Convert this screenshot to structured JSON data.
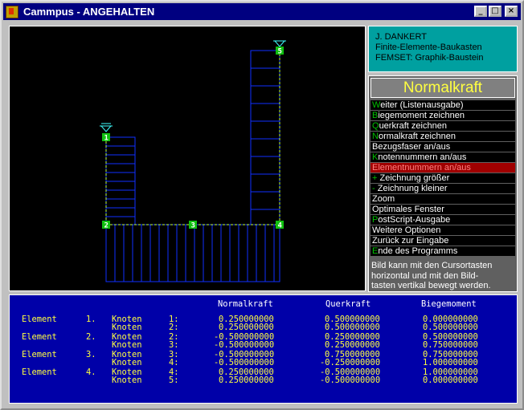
{
  "window": {
    "title": "Cammpus - ANGEHALTEN",
    "min_symbol": "_",
    "max_symbol": "□",
    "close_symbol": "×"
  },
  "info": {
    "line1": "J. DANKERT",
    "line2": "Finite-Elemente-Baukasten",
    "line3": "FEMSET:  Graphik-Baustein"
  },
  "menu": {
    "header": "Normalkraft",
    "items": [
      {
        "hk": "W",
        "rest": "eiter (Listenausgabe)"
      },
      {
        "hk": "B",
        "rest": "iegemoment zeichnen"
      },
      {
        "hk": "Q",
        "rest": "uerkraft zeichnen"
      },
      {
        "hk": "N",
        "rest": "ormalkraft zeichnen"
      },
      {
        "hk": "",
        "rest": "Bezugsfaser an/aus"
      },
      {
        "hk": "K",
        "rest": "notennummern  an/aus"
      },
      {
        "hk": "",
        "rest": "Elementnummern an/aus"
      },
      {
        "hk": "+",
        "rest": " Zeichnung größer"
      },
      {
        "hk": "-",
        "rest": " Zeichnung kleiner"
      },
      {
        "hk": "",
        "rest": "Zoom"
      },
      {
        "hk": "",
        "rest": "Optimales Fenster"
      },
      {
        "hk": "P",
        "rest": "ostScript-Ausgabe"
      },
      {
        "hk": "",
        "rest": "Weitere Optionen"
      },
      {
        "hk": "",
        "rest": "Zurück zur Eingabe"
      },
      {
        "hk": "E",
        "rest": "nde des Programms"
      }
    ],
    "hint_lines": [
      "Bild kann mit den Cursortasten",
      "horizontal und mit den Bild-",
      "tasten vertikal bewegt werden."
    ]
  },
  "nodes": [
    "1",
    "2",
    "3",
    "4",
    "5"
  ],
  "output": {
    "headers": [
      "Normalkraft",
      "Querkraft",
      "Biegemoment"
    ],
    "elements": [
      {
        "label": "Element",
        "num": "1.",
        "rows": [
          {
            "k": "Knoten",
            "n": "1:",
            "nk": "0.250000000",
            "qk": "0.500000000",
            "bm": "0.000000000"
          },
          {
            "k": "Knoten",
            "n": "2:",
            "nk": "0.250000000",
            "qk": "0.500000000",
            "bm": "0.500000000"
          }
        ]
      },
      {
        "label": "Element",
        "num": "2.",
        "rows": [
          {
            "k": "Knoten",
            "n": "2:",
            "nk": "-0.500000000",
            "qk": "0.250000000",
            "bm": "0.500000000"
          },
          {
            "k": "Knoten",
            "n": "3:",
            "nk": "-0.500000000",
            "qk": "0.250000000",
            "bm": "0.750000000"
          }
        ]
      },
      {
        "label": "Element",
        "num": "3.",
        "rows": [
          {
            "k": "Knoten",
            "n": "3:",
            "nk": "-0.500000000",
            "qk": "0.750000000",
            "bm": "0.750000000"
          },
          {
            "k": "Knoten",
            "n": "4:",
            "nk": "-0.500000000",
            "qk": "-0.250000000",
            "bm": "1.000000000"
          }
        ]
      },
      {
        "label": "Element",
        "num": "4.",
        "rows": [
          {
            "k": "Knoten",
            "n": "4:",
            "nk": "0.250000000",
            "qk": "-0.500000000",
            "bm": "1.000000000"
          },
          {
            "k": "Knoten",
            "n": "5:",
            "nk": "0.250000000",
            "qk": "-0.500000000",
            "bm": "0.000000000"
          }
        ]
      }
    ]
  }
}
